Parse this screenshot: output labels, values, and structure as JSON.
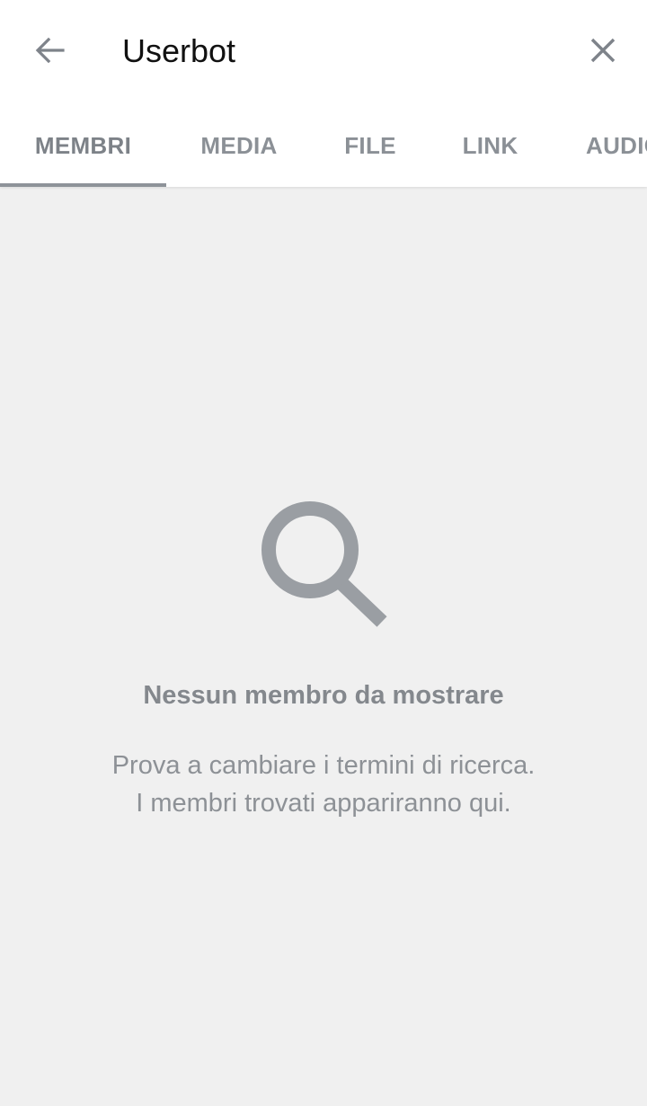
{
  "header": {
    "title": "Userbot",
    "back_icon": "arrow-left-icon",
    "close_icon": "close-icon"
  },
  "tabs": [
    {
      "label": "MEMBRI",
      "active": true
    },
    {
      "label": "MEDIA",
      "active": false
    },
    {
      "label": "FILE",
      "active": false
    },
    {
      "label": "LINK",
      "active": false
    },
    {
      "label": "AUDIO",
      "active": false
    }
  ],
  "empty_state": {
    "icon": "search-icon",
    "title": "Nessun membro da mostrare",
    "line1": "Prova a cambiare i termini di ricerca.",
    "line2": "I membri trovati appariranno qui."
  },
  "colors": {
    "background": "#f0f0f0",
    "header": "#ffffff",
    "icon_gray": "#8e9399",
    "text_gray": "#84888d"
  }
}
